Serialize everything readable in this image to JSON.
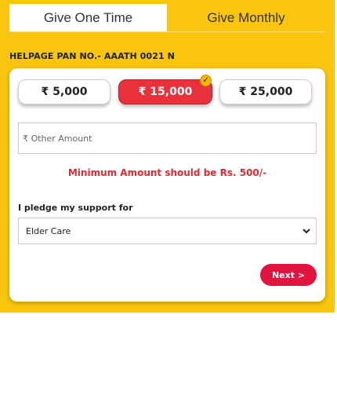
{
  "tabs": {
    "one_time": "Give One Time",
    "monthly": "Give Monthly"
  },
  "pan": "HELPAGE PAN NO.- AAATH 0021 N",
  "amounts": [
    "₹ 5,000",
    "₹ 15,000",
    "₹ 25,000"
  ],
  "selected_amount": "₹ 15,000",
  "other_amount": {
    "placeholder": "₹ Other Amount",
    "value": ""
  },
  "min_message": "Minimum Amount should be Rs. 500/-",
  "pledge": {
    "label": "I pledge my support for",
    "selected": "Elder Care"
  },
  "next_label": "Next >",
  "colors": {
    "background": "#f9c50e",
    "selected_amount": "#e8313a",
    "next_button": "#e0143f",
    "warning_text": "#e02a32"
  },
  "icons": {
    "selected": "check-icon",
    "dropdown": "chevron-down-icon"
  }
}
